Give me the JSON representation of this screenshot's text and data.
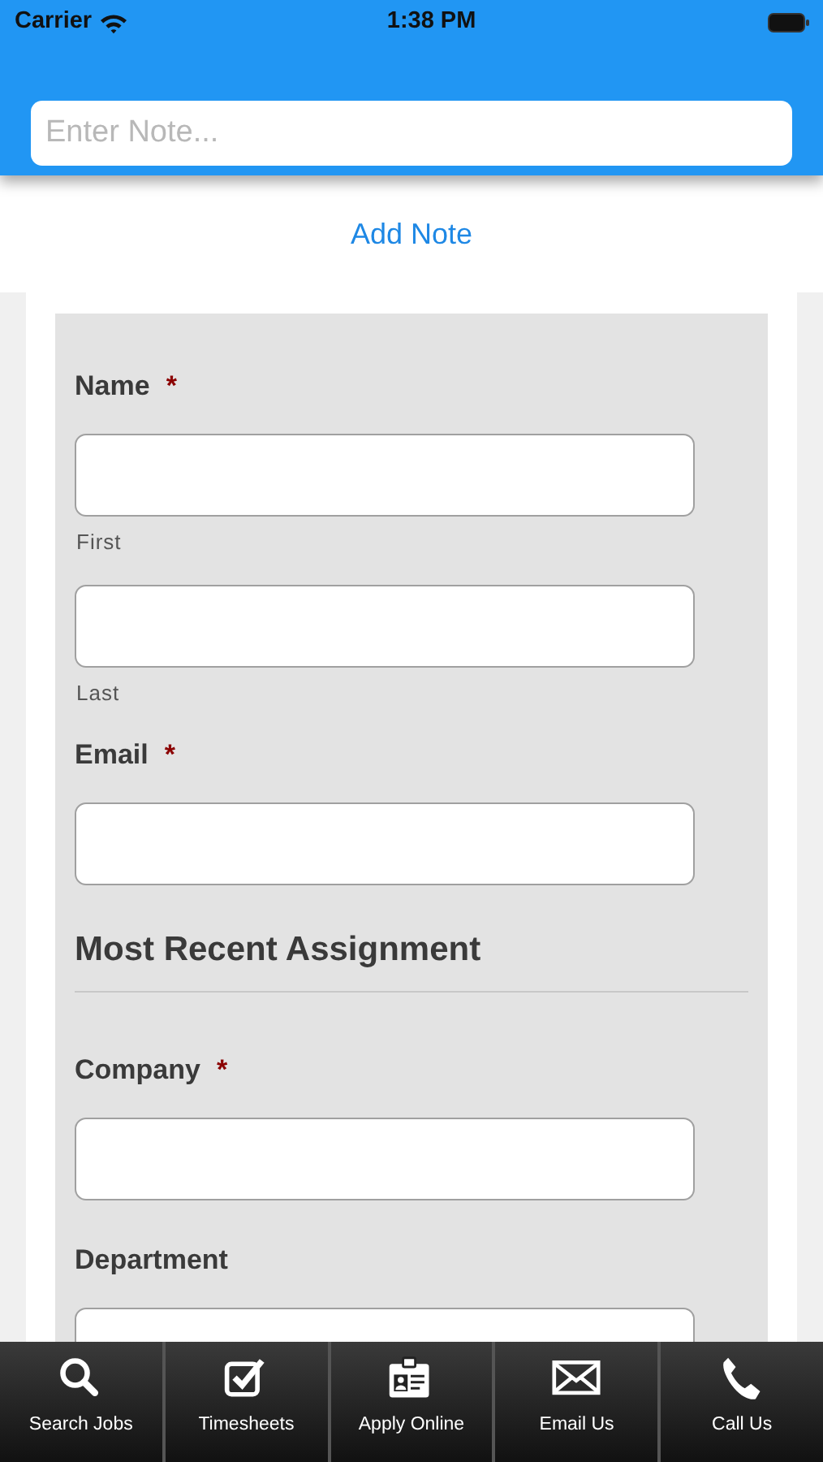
{
  "status_bar": {
    "carrier": "Carrier",
    "time": "1:38 PM"
  },
  "note": {
    "placeholder": "Enter Note...",
    "button": "Add Note"
  },
  "form": {
    "items": [
      {
        "kind": "label",
        "text": "Name",
        "mark": "*"
      },
      {
        "kind": "input",
        "sublabel": "First"
      },
      {
        "kind": "input",
        "sublabel": "Last"
      },
      {
        "kind": "label",
        "text": "Email",
        "mark": "*"
      },
      {
        "kind": "input"
      },
      {
        "kind": "section",
        "text": "Most Recent Assignment"
      },
      {
        "kind": "label",
        "text": "Company",
        "mark": "*"
      },
      {
        "kind": "input"
      },
      {
        "kind": "label",
        "text": "Department"
      },
      {
        "kind": "input"
      }
    ]
  },
  "tab_bar": [
    {
      "label": "Search Jobs"
    },
    {
      "label": "Timesheets"
    },
    {
      "label": "Apply Online"
    },
    {
      "label": "Email Us"
    },
    {
      "label": "Call Us"
    }
  ]
}
